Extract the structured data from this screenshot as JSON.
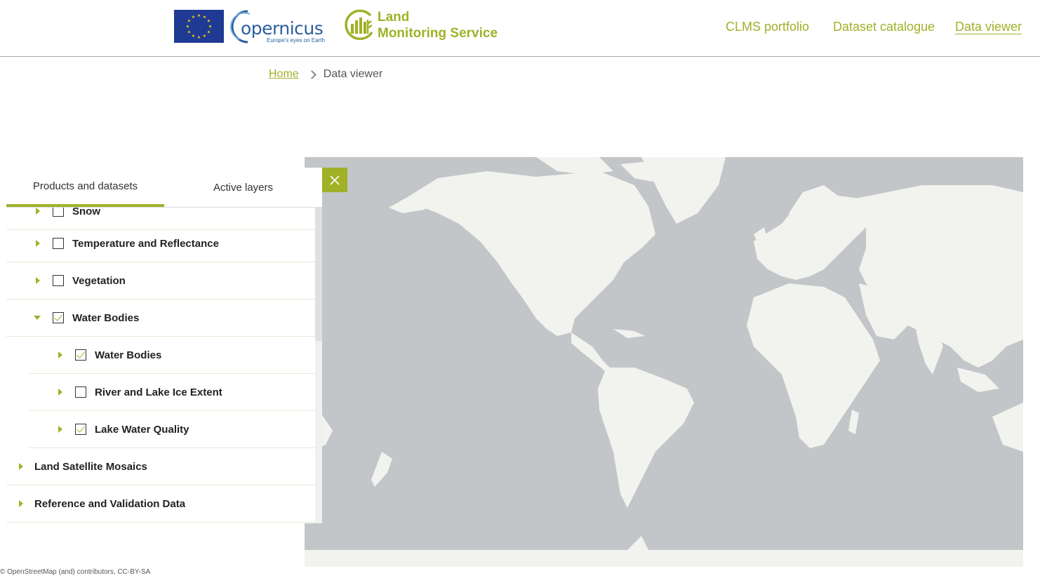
{
  "header": {
    "copernicus_word": "opernicus",
    "copernicus_tagline": "Europe's eyes on Earth",
    "lms_line1": "Land",
    "lms_line2": "Monitoring Service",
    "nav": [
      "CLMS portfolio",
      "Dataset catalogue",
      "Data viewer"
    ],
    "active_nav": "Data viewer"
  },
  "breadcrumb": {
    "home": "Home",
    "current": "Data viewer"
  },
  "panel": {
    "tabs": [
      "Products and datasets",
      "Active layers"
    ],
    "active_tab": "Products and datasets",
    "items": [
      {
        "label": "Snow",
        "checked": false,
        "expanded": false,
        "level": 1
      },
      {
        "label": "Temperature and Reflectance",
        "checked": false,
        "expanded": false,
        "level": 1
      },
      {
        "label": "Vegetation",
        "checked": false,
        "expanded": false,
        "level": 1
      },
      {
        "label": "Water Bodies",
        "checked": true,
        "expanded": true,
        "level": 1
      },
      {
        "label": "Water Bodies",
        "checked": true,
        "expanded": false,
        "level": 2
      },
      {
        "label": "River and Lake Ice Extent",
        "checked": false,
        "expanded": false,
        "level": 2
      },
      {
        "label": "Lake Water Quality",
        "checked": true,
        "expanded": false,
        "level": 2
      },
      {
        "label": "Land Satellite Mosaics",
        "checked": false,
        "expanded": false,
        "level": 0
      },
      {
        "label": "Reference and Validation Data",
        "checked": false,
        "expanded": false,
        "level": 0
      }
    ]
  },
  "map": {
    "attribution": "© OpenStreetMap (and) contributors, CC-BY-SA"
  },
  "colors": {
    "accent": "#a0b128",
    "ocean": "#c2c6c8",
    "land": "#f2f2ef",
    "eu_blue": "#1f3a93",
    "copernicus_blue": "#2a5f9e"
  }
}
